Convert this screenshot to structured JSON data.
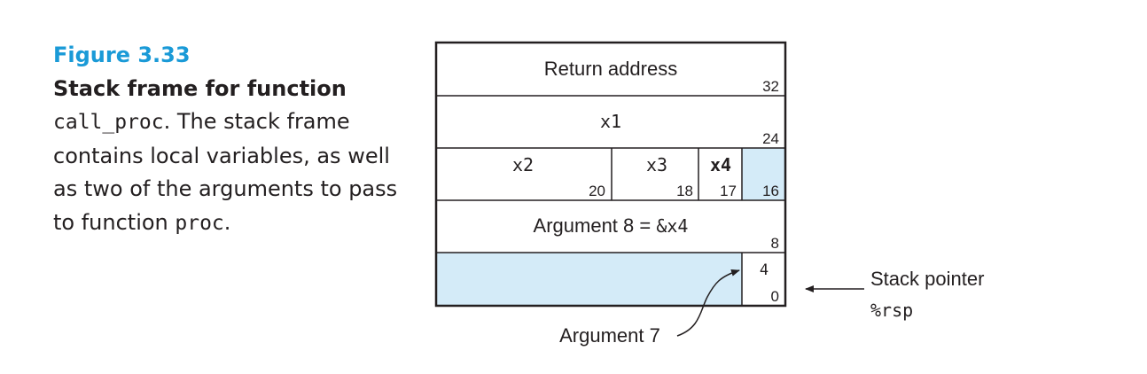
{
  "caption": {
    "figure_number": "Figure 3.33",
    "title": "Stack frame for function",
    "func_name": "call_proc",
    "text_1": ". The stack frame contains local variables, as well as two of the arguments to pass to function ",
    "callee": "proc",
    "text_2": "."
  },
  "stack": {
    "return_address": "Return address",
    "offset_32": "32",
    "x1": "x1",
    "offset_24": "24",
    "x2": "x2",
    "offset_20": "20",
    "x3": "x3",
    "offset_18": "18",
    "x4": "x4",
    "offset_17": "17",
    "offset_16": "16",
    "argument_8_label": "Argument 8 = ",
    "argument_8_value": "&x4",
    "offset_8": "8",
    "offset_4": "4",
    "offset_0": "0",
    "argument_7": "Argument 7",
    "stack_pointer": "Stack pointer",
    "rsp": "%rsp"
  },
  "colors": {
    "highlight": "#d4ebf8",
    "caption_accent": "#1a9ad7"
  }
}
